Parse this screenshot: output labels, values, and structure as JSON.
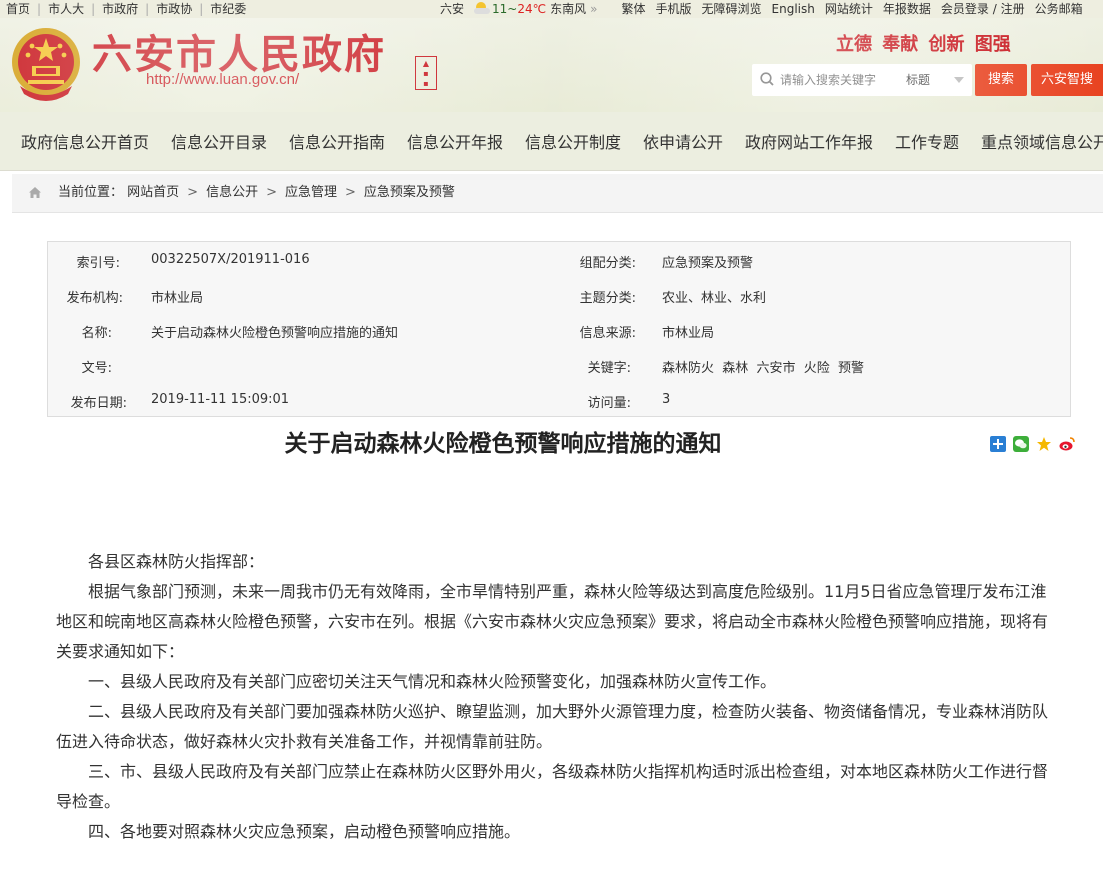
{
  "topbar": {
    "links": [
      "首页",
      "市人大",
      "市政府",
      "市政协",
      "市纪委"
    ],
    "city": "六安",
    "temp_low": "11",
    "temp_high": "24",
    "temp_unit": "℃",
    "wind": "东南风",
    "more": "»",
    "right_links": [
      "繁体",
      "手机版",
      "无障碍浏览",
      "English",
      "网站统计",
      "年报数据",
      "会员登录 / 注册",
      "公务邮箱"
    ]
  },
  "header": {
    "site_name": "六安市人民政府",
    "url": "http://www.luan.gov.cn/",
    "slogan": "立德 奉献 创新 图强",
    "search_placeholder": "请输入搜索关键字",
    "search_scope": "标题",
    "search_button": "搜索",
    "smart_button": "六安智搜"
  },
  "nav": {
    "items": [
      "政府信息公开首页",
      "信息公开目录",
      "信息公开指南",
      "信息公开年报",
      "信息公开制度",
      "依申请公开",
      "政府网站工作年报",
      "工作专题",
      "重点领域信息公开"
    ]
  },
  "breadcrumb": {
    "label": "当前位置：",
    "items": [
      "网站首页",
      "信息公开",
      "应急管理",
      "应急预案及预警"
    ],
    "separator": ">"
  },
  "info": {
    "index_no_label": "索引号:",
    "index_no": "00322507X/201911-016",
    "category_label": "组配分类:",
    "category": "应急预案及预警",
    "publisher_label": "发布机构:",
    "publisher": "市林业局",
    "topic_label": "主题分类:",
    "topic": "农业、林业、水利",
    "name_label": "名称:",
    "name": "关于启动森林火险橙色预警响应措施的通知",
    "source_label": "信息来源:",
    "source": "市林业局",
    "doc_no_label": "文号:",
    "doc_no": "",
    "keywords_label": "关键字:",
    "keywords": "森林防火  森林  六安市  火险  预警",
    "date_label": "发布日期:",
    "date": "2019-11-11 15:09:01",
    "visits_label": "访问量:",
    "visits": "3"
  },
  "article": {
    "title": "关于启动森林火险橙色预警响应措施的通知",
    "paragraphs": [
      "各县区森林防火指挥部：",
      "根据气象部门预测，未来一周我市仍无有效降雨，全市旱情特别严重，森林火险等级达到高度危险级别。11月5日省应急管理厅发布江淮地区和皖南地区高森林火险橙色预警，六安市在列。根据《六安市森林火灾应急预案》要求，将启动全市森林火险橙色预警响应措施，现将有关要求通知如下：",
      "一、县级人民政府及有关部门应密切关注天气情况和森林火险预警变化，加强森林防火宣传工作。",
      "二、县级人民政府及有关部门要加强森林防火巡护、瞭望监测，加大野外火源管理力度，检查防火装备、物资储备情况，专业森林消防队伍进入待命状态，做好森林火灾扑救有关准备工作，并视情靠前驻防。",
      "三、市、县级人民政府及有关部门应禁止在森林防火区野外用火，各级森林防火指挥机构适时派出检查组，对本地区森林防火工作进行督导检查。",
      "四、各地要对照森林火灾应急预案，启动橙色预警响应措施。"
    ]
  },
  "share_icons": [
    "plus-share-icon",
    "wechat-icon",
    "favorite-star-icon",
    "weibo-icon"
  ],
  "colors": {
    "brand_red": "#c8161d",
    "button_orange": "#e8401d",
    "header_bg": "#eceee0"
  }
}
